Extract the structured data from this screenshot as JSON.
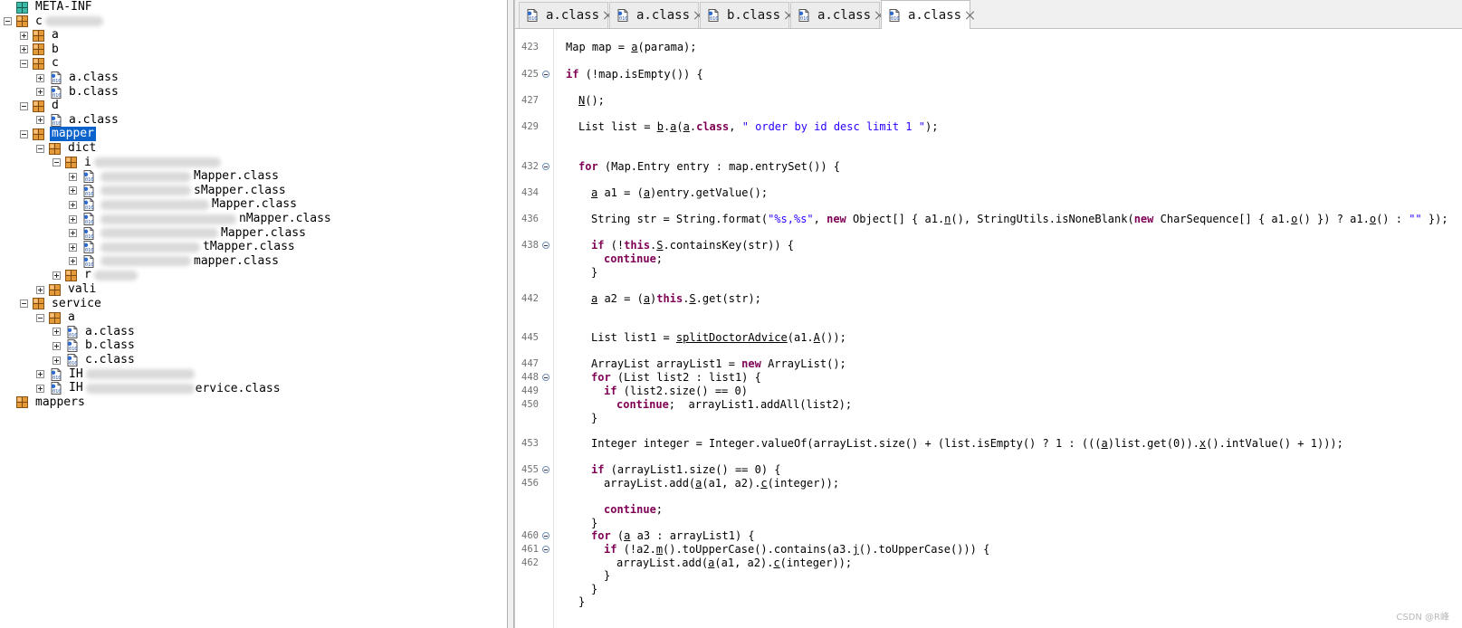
{
  "tree": {
    "selected": "mapper",
    "items": [
      {
        "label": "META-INF",
        "toggle": "none",
        "icon": "globe-package-icon",
        "depth": 0
      },
      {
        "label": "c",
        "toggle": "minus",
        "icon": "package-icon",
        "depth": 0,
        "blurred_after": true
      },
      {
        "label": "a",
        "toggle": "plus",
        "icon": "package-icon",
        "depth": 1
      },
      {
        "label": "b",
        "toggle": "plus",
        "icon": "package-icon",
        "depth": 1
      },
      {
        "label": "c",
        "toggle": "minus",
        "icon": "package-icon",
        "depth": 1
      },
      {
        "label": "a.class",
        "toggle": "plus",
        "icon": "class-file-icon",
        "depth": 2
      },
      {
        "label": "b.class",
        "toggle": "plus",
        "icon": "class-file-icon",
        "depth": 2
      },
      {
        "label": "d",
        "toggle": "minus",
        "icon": "package-icon",
        "depth": 1
      },
      {
        "label": "a.class",
        "toggle": "plus",
        "icon": "class-file-icon",
        "depth": 2
      },
      {
        "label": "mapper",
        "toggle": "minus",
        "icon": "package-icon",
        "depth": 1
      },
      {
        "label": "dict",
        "toggle": "minus",
        "icon": "package-icon",
        "depth": 2
      },
      {
        "label": "i",
        "toggle": "minus",
        "icon": "package-icon",
        "depth": 3,
        "blurred_after": true
      },
      {
        "label": "Mapper.class",
        "toggle": "plus",
        "icon": "class-file-icon",
        "depth": 4,
        "blurred_before": true
      },
      {
        "label": "sMapper.class",
        "toggle": "plus",
        "icon": "class-file-icon",
        "depth": 4,
        "blurred_before": true
      },
      {
        "label": "Mapper.class",
        "toggle": "plus",
        "icon": "class-file-icon",
        "depth": 4,
        "blurred_before": true
      },
      {
        "label": "nMapper.class",
        "toggle": "plus",
        "icon": "class-file-icon",
        "depth": 4,
        "blurred_before": true
      },
      {
        "label": "Mapper.class",
        "toggle": "plus",
        "icon": "class-file-icon",
        "depth": 4,
        "blurred_before": true
      },
      {
        "label": "tMapper.class",
        "toggle": "plus",
        "icon": "class-file-icon",
        "depth": 4,
        "blurred_before": true
      },
      {
        "label": "mapper.class",
        "toggle": "plus",
        "icon": "class-file-icon",
        "depth": 4,
        "blurred_before": true
      },
      {
        "label": "r",
        "toggle": "plus",
        "icon": "package-icon",
        "depth": 3,
        "blurred_after": true
      },
      {
        "label": "vali",
        "toggle": "plus",
        "icon": "package-icon",
        "depth": 2
      },
      {
        "label": "service",
        "toggle": "minus",
        "icon": "package-icon",
        "depth": 1
      },
      {
        "label": "a",
        "toggle": "minus",
        "icon": "package-icon",
        "depth": 2
      },
      {
        "label": "a.class",
        "toggle": "plus",
        "icon": "class-file-icon",
        "depth": 3
      },
      {
        "label": "b.class",
        "toggle": "plus",
        "icon": "class-file-icon",
        "depth": 3
      },
      {
        "label": "c.class",
        "toggle": "plus",
        "icon": "class-file-icon",
        "depth": 3
      },
      {
        "label": "IH",
        "toggle": "plus",
        "icon": "class-file-icon",
        "depth": 2,
        "blurred_after": true
      },
      {
        "label": "IH",
        "toggle": "plus",
        "icon": "class-file-icon",
        "depth": 2,
        "blurred_after": true,
        "suffix": "ervice.class"
      },
      {
        "label": "mappers",
        "toggle": "none",
        "icon": "package-icon",
        "depth": 0
      }
    ]
  },
  "tabs": [
    {
      "label": "a.class",
      "active": false
    },
    {
      "label": "a.class",
      "active": false
    },
    {
      "label": "b.class",
      "active": false
    },
    {
      "label": "a.class",
      "active": false
    },
    {
      "label": "a.class",
      "active": true
    }
  ],
  "code": [
    {
      "n": "423",
      "fold": false,
      "indent": 1,
      "tokens": [
        [
          "",
          "Map map = "
        ],
        [
          "u",
          "a"
        ],
        [
          "",
          "(parama);"
        ]
      ]
    },
    {
      "n": "425",
      "fold": true,
      "indent": 1,
      "tokens": [
        [
          "kw",
          "if"
        ],
        [
          "",
          " (!map.isEmpty()) {"
        ]
      ]
    },
    {
      "n": "427",
      "fold": false,
      "indent": 2,
      "tokens": [
        [
          "u",
          "N"
        ],
        [
          "",
          "();"
        ]
      ]
    },
    {
      "n": "429",
      "fold": false,
      "indent": 2,
      "tokens": [
        [
          "",
          "List list = "
        ],
        [
          "u",
          "b"
        ],
        [
          "",
          "."
        ],
        [
          "u",
          "a"
        ],
        [
          "",
          "("
        ],
        [
          "u",
          "a"
        ],
        [
          "",
          "."
        ],
        [
          "kw",
          "class"
        ],
        [
          "",
          ", "
        ],
        [
          "str",
          "\" order by id desc limit 1 \""
        ],
        [
          "",
          ");"
        ]
      ]
    },
    {
      "n": "432",
      "fold": true,
      "indent": 2,
      "tokens": [
        [
          "kw",
          "for"
        ],
        [
          "",
          " (Map.Entry entry : map.entrySet()) {"
        ]
      ]
    },
    {
      "n": "434",
      "fold": false,
      "indent": 3,
      "tokens": [
        [
          "u",
          "a"
        ],
        [
          "",
          " a1 = ("
        ],
        [
          "u",
          "a"
        ],
        [
          "",
          ")entry.getValue();"
        ]
      ]
    },
    {
      "n": "436",
      "fold": false,
      "indent": 3,
      "tokens": [
        [
          "",
          "String str = String.format("
        ],
        [
          "str",
          "\"%s,%s\""
        ],
        [
          "",
          ", "
        ],
        [
          "kw",
          "new"
        ],
        [
          "",
          " Object[] { a1."
        ],
        [
          "u",
          "n"
        ],
        [
          "",
          "(), StringUtils.isNoneBlank("
        ],
        [
          "kw",
          "new"
        ],
        [
          "",
          " CharSequence[] { a1."
        ],
        [
          "u",
          "o"
        ],
        [
          "",
          "() }) ? a1."
        ],
        [
          "u",
          "o"
        ],
        [
          "",
          "() : "
        ],
        [
          "str",
          "\"\""
        ],
        [
          "",
          " });"
        ]
      ]
    },
    {
      "n": "438",
      "fold": true,
      "indent": 3,
      "tokens": [
        [
          "kw",
          "if"
        ],
        [
          "",
          " (!"
        ],
        [
          "kw",
          "this"
        ],
        [
          "",
          "."
        ],
        [
          "u",
          "S"
        ],
        [
          "",
          ".containsKey(str)) {"
        ]
      ]
    },
    {
      "n": "",
      "fold": false,
      "indent": 4,
      "tokens": [
        [
          "kw",
          "continue"
        ],
        [
          "",
          ";"
        ]
      ]
    },
    {
      "n": "",
      "fold": false,
      "indent": 3,
      "tokens": [
        [
          "",
          "}"
        ]
      ]
    },
    {
      "n": "442",
      "fold": false,
      "indent": 3,
      "tokens": [
        [
          "u",
          "a"
        ],
        [
          "",
          " a2 = ("
        ],
        [
          "u",
          "a"
        ],
        [
          "",
          ")"
        ],
        [
          "kw",
          "this"
        ],
        [
          "",
          "."
        ],
        [
          "u",
          "S"
        ],
        [
          "",
          ".get(str);"
        ]
      ]
    },
    {
      "n": "445",
      "fold": false,
      "indent": 3,
      "tokens": [
        [
          "",
          "List list1 = "
        ],
        [
          "u",
          "splitDoctorAdvice"
        ],
        [
          "",
          "(a1."
        ],
        [
          "u",
          "A"
        ],
        [
          "",
          "());"
        ]
      ]
    },
    {
      "n": "447",
      "fold": false,
      "indent": 3,
      "tokens": [
        [
          "",
          "ArrayList arrayList1 = "
        ],
        [
          "kw",
          "new"
        ],
        [
          "",
          " ArrayList();"
        ]
      ]
    },
    {
      "n": "448",
      "fold": true,
      "indent": 3,
      "tokens": [
        [
          "kw",
          "for"
        ],
        [
          "",
          " (List list2 : list1) {"
        ]
      ]
    },
    {
      "n": "449",
      "fold": false,
      "indent": 4,
      "tokens": [
        [
          "kw",
          "if"
        ],
        [
          "",
          " (list2.size() == 0)"
        ]
      ]
    },
    {
      "n": "450",
      "fold": false,
      "indent": 5,
      "tokens": [
        [
          "kw",
          "continue"
        ],
        [
          "",
          ";  arrayList1.addAll(list2);"
        ]
      ]
    },
    {
      "n": "",
      "fold": false,
      "indent": 3,
      "tokens": [
        [
          "",
          "}"
        ]
      ]
    },
    {
      "n": "453",
      "fold": false,
      "indent": 3,
      "tokens": [
        [
          "",
          "Integer integer = Integer.valueOf(arrayList.size() + (list.isEmpty() ? 1 : ((("
        ],
        [
          "u",
          "a"
        ],
        [
          "",
          ")list.get(0))."
        ],
        [
          "u",
          "x"
        ],
        [
          "",
          "().intValue() + 1)));"
        ]
      ]
    },
    {
      "n": "455",
      "fold": true,
      "indent": 3,
      "tokens": [
        [
          "kw",
          "if"
        ],
        [
          "",
          " (arrayList1.size() == 0) {"
        ]
      ]
    },
    {
      "n": "456",
      "fold": false,
      "indent": 4,
      "tokens": [
        [
          "",
          "arrayList.add("
        ],
        [
          "u",
          "a"
        ],
        [
          "",
          "(a1, a2)."
        ],
        [
          "u",
          "c"
        ],
        [
          "",
          "(integer));"
        ]
      ]
    },
    {
      "n": "",
      "fold": false,
      "indent": 4,
      "tokens": [
        [
          "kw",
          "continue"
        ],
        [
          "",
          ";"
        ]
      ]
    },
    {
      "n": "",
      "fold": false,
      "indent": 3,
      "tokens": [
        [
          "",
          "}"
        ]
      ]
    },
    {
      "n": "460",
      "fold": true,
      "indent": 3,
      "tokens": [
        [
          "kw",
          "for"
        ],
        [
          "",
          " ("
        ],
        [
          "u",
          "a"
        ],
        [
          "",
          " a3 : arrayList1) {"
        ]
      ]
    },
    {
      "n": "461",
      "fold": true,
      "indent": 4,
      "tokens": [
        [
          "kw",
          "if"
        ],
        [
          "",
          " (!a2."
        ],
        [
          "u",
          "m"
        ],
        [
          "",
          "().toUpperCase().contains(a3."
        ],
        [
          "u",
          "j"
        ],
        [
          "",
          "().toUpperCase())) {"
        ]
      ]
    },
    {
      "n": "462",
      "fold": false,
      "indent": 5,
      "tokens": [
        [
          "",
          "arrayList.add("
        ],
        [
          "u",
          "a"
        ],
        [
          "",
          "(a1, a2)."
        ],
        [
          "u",
          "c"
        ],
        [
          "",
          "(integer));"
        ]
      ]
    },
    {
      "n": "",
      "fold": false,
      "indent": 4,
      "tokens": [
        [
          "",
          "}"
        ]
      ]
    },
    {
      "n": "",
      "fold": false,
      "indent": 3,
      "tokens": [
        [
          "",
          "}"
        ]
      ]
    },
    {
      "n": "",
      "fold": false,
      "indent": 2,
      "tokens": [
        [
          "",
          "}"
        ]
      ]
    }
  ],
  "watermark": "CSDN @R峰",
  "colors": {
    "selection": "#0a63cc",
    "keyword": "#7f0055",
    "string": "#2a00ff"
  }
}
